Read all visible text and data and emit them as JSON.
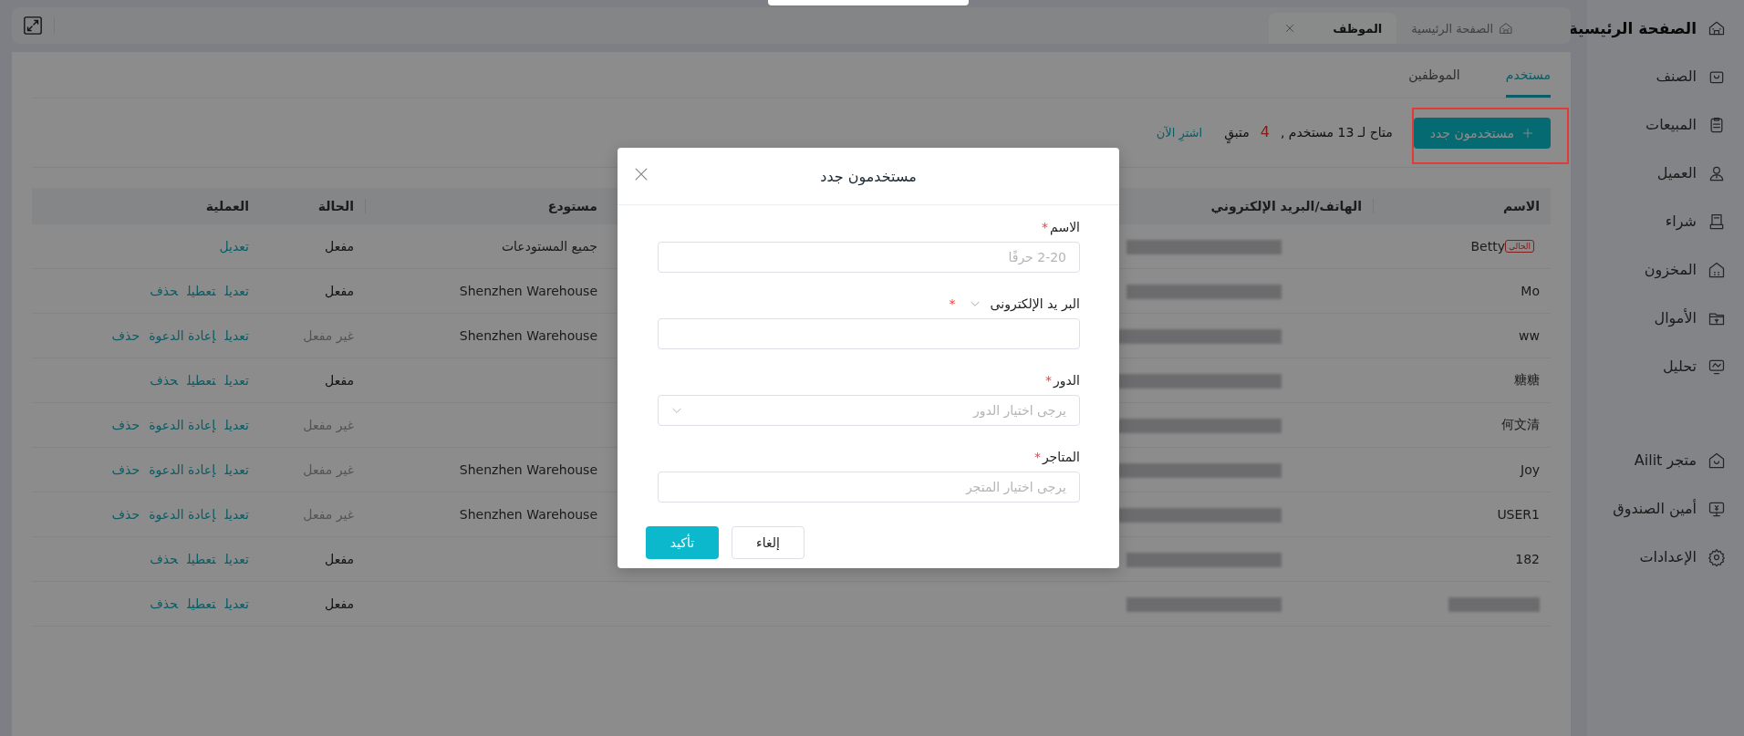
{
  "sidebar": {
    "items": [
      {
        "label": "الصفحة الرئيسية",
        "selected": true
      },
      {
        "label": "الصنف",
        "selected": false
      },
      {
        "label": "المبيعات",
        "selected": false
      },
      {
        "label": "العميل",
        "selected": false
      },
      {
        "label": "شراء",
        "selected": false
      },
      {
        "label": "المخزون",
        "selected": false
      },
      {
        "label": "الأموال",
        "selected": false
      },
      {
        "label": "تحليل",
        "selected": false
      }
    ],
    "bottom_items": [
      {
        "label": "متجر Ailit",
        "selected": false
      },
      {
        "label": "أمين الصندوق",
        "selected": false
      },
      {
        "label": "الإعدادات",
        "selected": false
      }
    ]
  },
  "header_tabs": [
    {
      "label": "الصفحة الرئيسية",
      "selected": false,
      "closable": false
    },
    {
      "label": "الموظف",
      "selected": true,
      "closable": true
    }
  ],
  "page_tabs": [
    {
      "label": "مستخدم",
      "selected": true
    },
    {
      "label": "الموظفين",
      "selected": false
    }
  ],
  "toolbar": {
    "add_button": "مستخدمون جدد",
    "highlighted": true,
    "quota_text": "متاح لـ 13 مستخدم ,",
    "remaining_count": "4",
    "remaining_label": "متبقٍ",
    "buy_link": "اشترِ الآن"
  },
  "table": {
    "columns": [
      "الاسم",
      "الهاتف/البريد الإلكتروني",
      "مستودع",
      "الحالة",
      "العملية"
    ],
    "rows": [
      {
        "name": "Betty",
        "current_tag": "الحالي",
        "name_redacted": false,
        "contact_redacted": true,
        "warehouse": "جميع المستودعات",
        "status": "مفعل",
        "enabled": true,
        "actions": [
          "تعديل"
        ]
      },
      {
        "name": "Mo",
        "name_redacted": false,
        "contact_redacted": true,
        "warehouse": "Shenzhen Warehouse",
        "status": "مفعل",
        "enabled": true,
        "actions": [
          "تعديل",
          "تعطيل",
          "حذف"
        ]
      },
      {
        "name": "ww",
        "name_redacted": false,
        "contact_redacted": true,
        "warehouse": "Shenzhen Warehouse",
        "status": "غير مفعل",
        "enabled": false,
        "actions": [
          "تعديل",
          "إعادة الدعوة",
          "حذف"
        ]
      },
      {
        "name": "糖糖",
        "name_redacted": false,
        "contact_redacted": true,
        "status": "مفعل",
        "enabled": true,
        "actions": [
          "تعديل",
          "تعطيل",
          "حذف"
        ]
      },
      {
        "name": "何文清",
        "name_redacted": false,
        "contact_redacted": true,
        "status": "غير مفعل",
        "enabled": false,
        "actions": [
          "تعديل",
          "إعادة الدعوة",
          "حذف"
        ]
      },
      {
        "name": "Joy",
        "name_redacted": false,
        "contact_redacted": true,
        "warehouse": "Shenzhen Warehouse",
        "status": "غير مفعل",
        "enabled": false,
        "actions": [
          "تعديل",
          "إعادة الدعوة",
          "حذف"
        ]
      },
      {
        "name": "USER1",
        "name_redacted": false,
        "contact_redacted": true,
        "warehouse": "Shenzhen Warehouse",
        "status": "غير مفعل",
        "enabled": false,
        "actions": [
          "تعديل",
          "إعادة الدعوة",
          "حذف"
        ]
      },
      {
        "name": "182",
        "name_redacted": false,
        "contact_redacted": true,
        "status": "مفعل",
        "enabled": true,
        "actions": [
          "تعديل",
          "تعطيل",
          "حذف"
        ]
      },
      {
        "name_redacted": true,
        "contact_redacted": true,
        "status": "مفعل",
        "enabled": true,
        "actions": [
          "تعديل",
          "تعطيل",
          "حذف"
        ]
      }
    ]
  },
  "dialog": {
    "title": "مستخدمون جدد",
    "fields": [
      {
        "kind": "input",
        "label": "الاسم",
        "required_mark": "*",
        "placeholder": "2-20 حرفًا"
      },
      {
        "kind": "input",
        "label": "البر يد الإلكترونى",
        "type_dropdown": true,
        "required_mark": "*"
      },
      {
        "kind": "select",
        "label": "الدور",
        "required_mark": "*",
        "placeholder": "يرجى اختيار الدور"
      },
      {
        "kind": "input",
        "label": "المتاجر",
        "required_mark": "*",
        "placeholder": "يرجى اختيار المتجر"
      }
    ],
    "buttons": [
      {
        "label": "إلغاء",
        "kind": "default"
      },
      {
        "label": "تأكيد",
        "kind": "primary"
      }
    ]
  }
}
